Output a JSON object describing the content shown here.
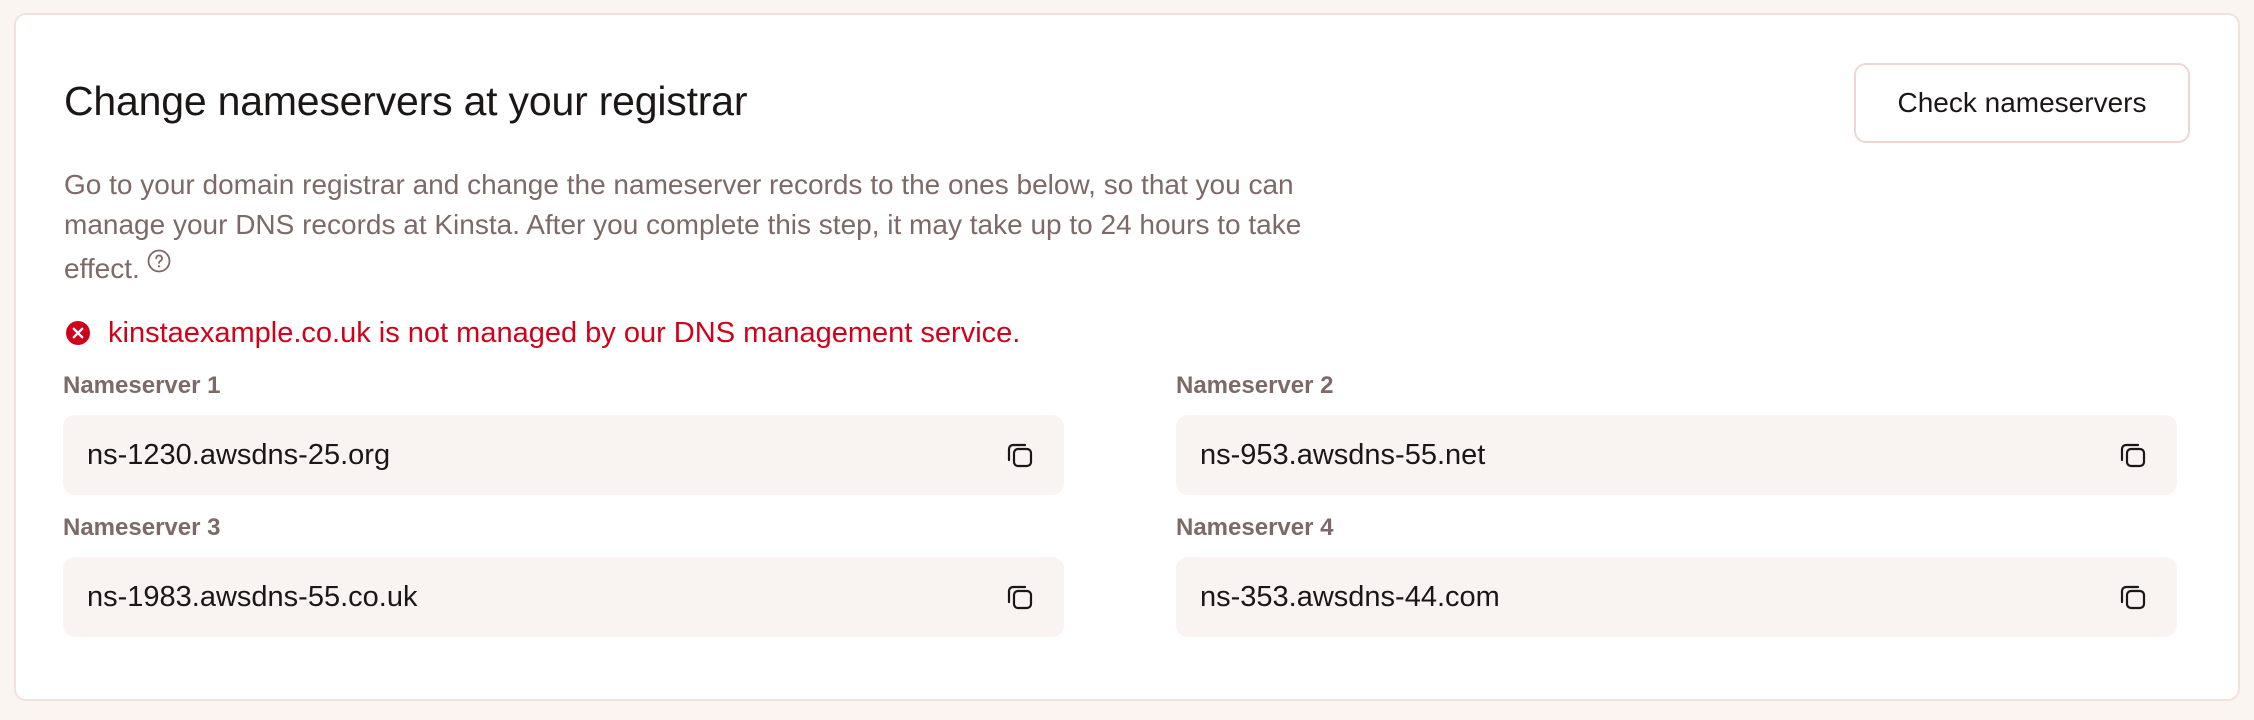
{
  "header": {
    "title": "Change nameservers at your registrar",
    "check_button_label": "Check nameservers"
  },
  "description": "Go to your domain registrar and change the nameserver records to the ones below, so that you can manage your DNS records at Kinsta. After you complete this step, it may take up to 24 hours to take effect.",
  "error": {
    "message": "kinstaexample.co.uk is not managed by our DNS management service.",
    "color": "#d0021b"
  },
  "nameservers": [
    {
      "label": "Nameserver 1",
      "value": "ns-1230.awsdns-25.org"
    },
    {
      "label": "Nameserver 2",
      "value": "ns-953.awsdns-55.net"
    },
    {
      "label": "Nameserver 3",
      "value": "ns-1983.awsdns-55.co.uk"
    },
    {
      "label": "Nameserver 4",
      "value": "ns-353.awsdns-44.com"
    }
  ],
  "icons": {
    "help": "help-circle-icon",
    "error": "error-circle-icon",
    "copy": "copy-icon"
  }
}
